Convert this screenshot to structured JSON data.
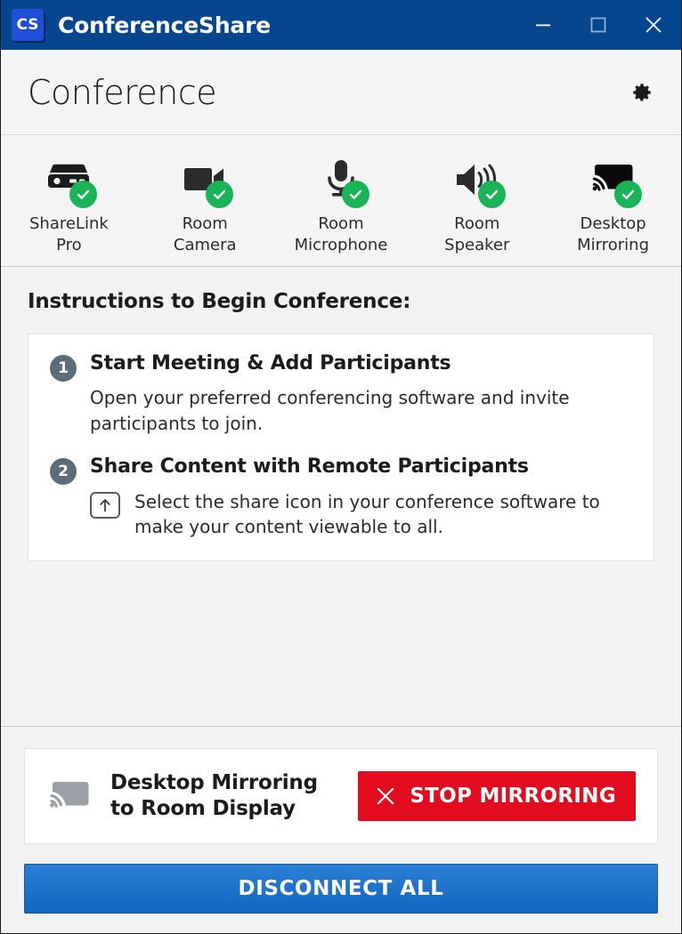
{
  "window": {
    "logo_text": "CS",
    "title": "ConferenceShare",
    "controls": {
      "minimize": "minimize-icon",
      "maximize": "maximize-icon",
      "close": "close-icon"
    }
  },
  "header": {
    "title": "Conference",
    "settings_icon": "gear-icon"
  },
  "devices": [
    {
      "id": "sharelink-pro",
      "icon": "set-top-box-icon",
      "label": "ShareLink\nPro",
      "status": "connected",
      "status_icon": "check-circle-icon"
    },
    {
      "id": "room-camera",
      "icon": "video-camera-icon",
      "label": "Room\nCamera",
      "status": "connected",
      "status_icon": "check-circle-icon"
    },
    {
      "id": "room-microphone",
      "icon": "microphone-icon",
      "label": "Room\nMicrophone",
      "status": "connected",
      "status_icon": "check-circle-icon"
    },
    {
      "id": "room-speaker",
      "icon": "speaker-icon",
      "label": "Room\nSpeaker",
      "status": "connected",
      "status_icon": "check-circle-icon"
    },
    {
      "id": "desktop-mirroring",
      "icon": "cast-screen-icon",
      "label": "Desktop\nMirroring",
      "status": "connected",
      "status_icon": "check-circle-icon"
    }
  ],
  "instructions": {
    "heading": "Instructions to Begin Conference:",
    "steps": [
      {
        "number": "1",
        "title": "Start Meeting & Add Participants",
        "description": "Open your preferred conferencing software and invite participants to join."
      },
      {
        "number": "2",
        "title": "Share Content with Remote Participants",
        "icon": "share-up-arrow-icon",
        "description": "Select the share icon in your conference software to make your content viewable to all."
      }
    ]
  },
  "footer": {
    "mirror_status": {
      "icon": "cast-screen-icon",
      "label": "Desktop Mirroring\nto Room Display"
    },
    "stop_button": {
      "label": "STOP MIRRORING",
      "icon": "x-icon"
    },
    "disconnect_button": {
      "label": "DISCONNECT ALL"
    }
  },
  "colors": {
    "titlebar_blue": "#05468f",
    "logo_blue": "#1f4fd8",
    "status_green": "#18b457",
    "stop_red": "#e30b1e",
    "disconnect_blue": "#2b7fd4",
    "step_badge_gray": "#5e6b7a",
    "cast_gray": "#9aa0a6"
  }
}
